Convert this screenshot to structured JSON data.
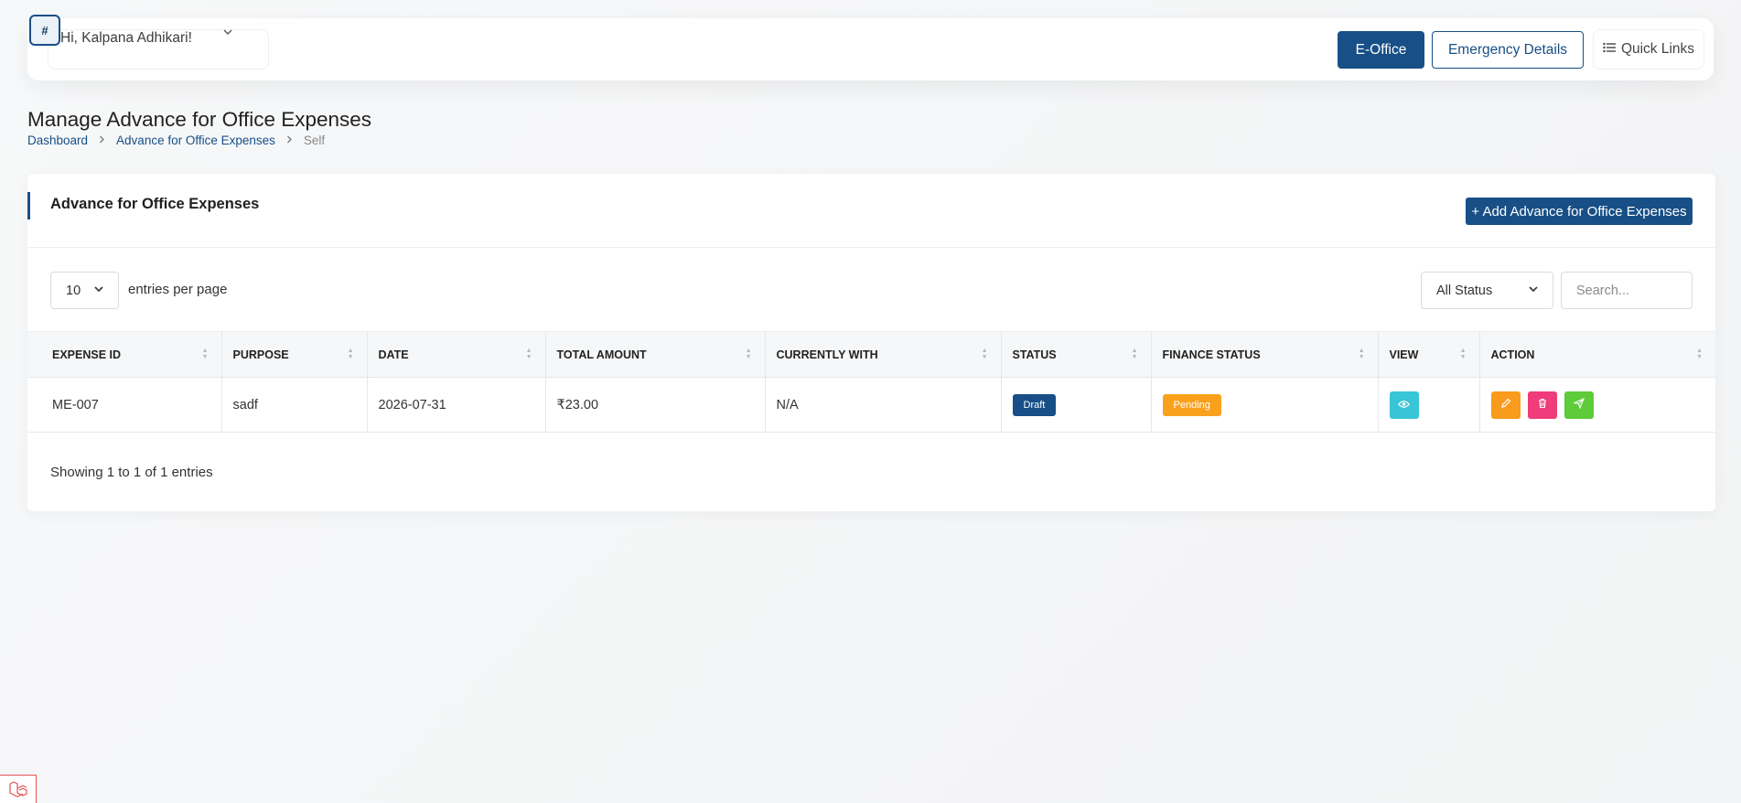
{
  "header": {
    "greeting": "Hi, Kalpana Adhikari!",
    "avatar_text": "#",
    "eoffice_label": "E-Office",
    "emergency_label": "Emergency Details",
    "quick_links_label": "Quick Links"
  },
  "page": {
    "title": "Manage Advance for Office Expenses",
    "breadcrumb": [
      "Dashboard",
      "Advance for Office Expenses",
      "Self"
    ]
  },
  "card": {
    "title": "Advance for Office Expenses",
    "add_button_label": "+ Add Advance for Office Expenses"
  },
  "filters": {
    "per_page_value": "10",
    "per_page_label": "entries per page",
    "status_value": "All Status",
    "search_placeholder": "Search..."
  },
  "table": {
    "columns": [
      "EXPENSE ID",
      "PURPOSE",
      "DATE",
      "TOTAL AMOUNT",
      "CURRENTLY WITH",
      "STATUS",
      "FINANCE STATUS",
      "VIEW",
      "ACTION"
    ],
    "rows": [
      {
        "expense_id": "ME-007",
        "purpose": "sadf",
        "date": "2026-07-31",
        "total_amount": "₹23.00",
        "currently_with": "N/A",
        "status": "Draft",
        "finance_status": "Pending"
      }
    ]
  },
  "footer": {
    "showing": "Showing 1 to 1 of 1 entries"
  },
  "colors": {
    "primary": "#174f86",
    "draft_badge": "#174f86",
    "pending_badge": "#f9a11c",
    "view_button": "#38c5d6",
    "edit_button": "#f99b1c",
    "delete_button": "#f03c7a",
    "send_button": "#5dcb3a"
  },
  "icons": {
    "view": "eye-icon",
    "edit": "pencil-icon",
    "delete": "trash-icon",
    "send": "paper-plane-icon",
    "quick_links": "list-icon",
    "corner": "laravel-logo-icon"
  }
}
